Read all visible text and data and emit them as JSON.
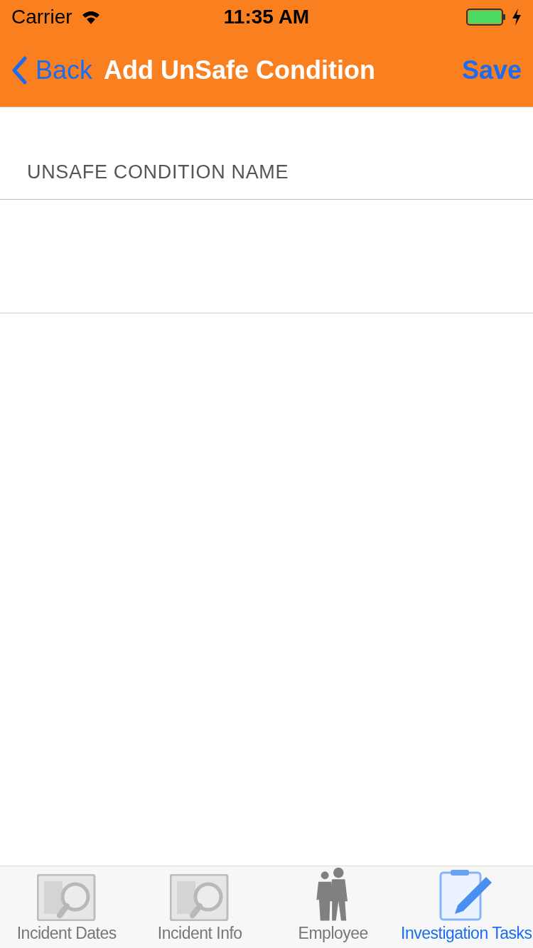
{
  "status_bar": {
    "carrier": "Carrier",
    "time": "11:35 AM"
  },
  "nav_bar": {
    "back": "Back",
    "title": "Add UnSafe Condition",
    "action": "Save"
  },
  "section": {
    "header": "UNSAFE CONDITION NAME"
  },
  "tabs": [
    {
      "label": "Incident Dates",
      "kind": "document-search",
      "selected": false
    },
    {
      "label": "Incident Info",
      "kind": "document-search",
      "selected": false
    },
    {
      "label": "Employee",
      "kind": "people",
      "selected": false
    },
    {
      "label": "Investigation Tasks",
      "kind": "clipboard",
      "selected": true
    }
  ]
}
